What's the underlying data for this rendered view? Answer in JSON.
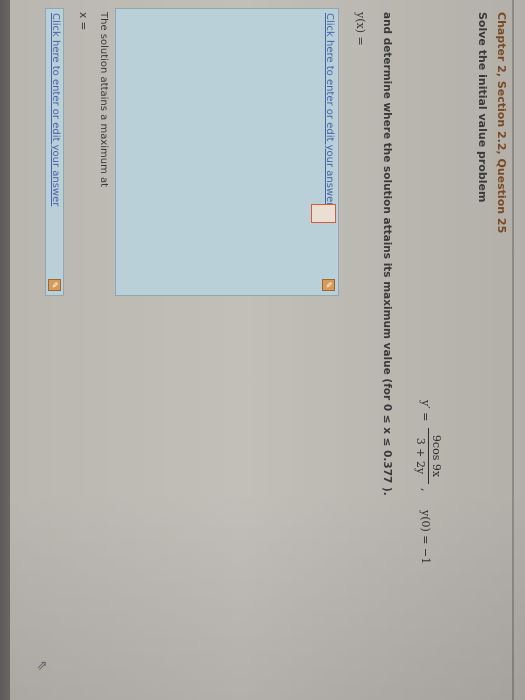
{
  "question": {
    "title": "Chapter 2, Section 2.2, Question 25",
    "instruction": "Solve the initial value problem"
  },
  "equation": {
    "lhs": "y′ =",
    "numerator": "9cos 9x",
    "denominator": "3 + 2y",
    "separator": ",",
    "initial_condition": "y(0) = −1"
  },
  "task": "and determine where the solution attains its maximum value (for  0 ≤ x ≤ 0.377 ).",
  "answer1": {
    "label": "y(x) =",
    "hint": "Click here to enter or edit your answer"
  },
  "max_statement": "The solution attains a maximum at",
  "answer2": {
    "label": "x =",
    "hint": "Click here to enter or edit your answer"
  },
  "icons": {
    "edit": "edit-pencil-icon",
    "cursor": "mouse-pointer-icon"
  },
  "colors": {
    "answer_box": "#b9d0d8",
    "link": "#4a63a8",
    "placeholder_border": "#d9593a",
    "title": "#7a4a22"
  }
}
